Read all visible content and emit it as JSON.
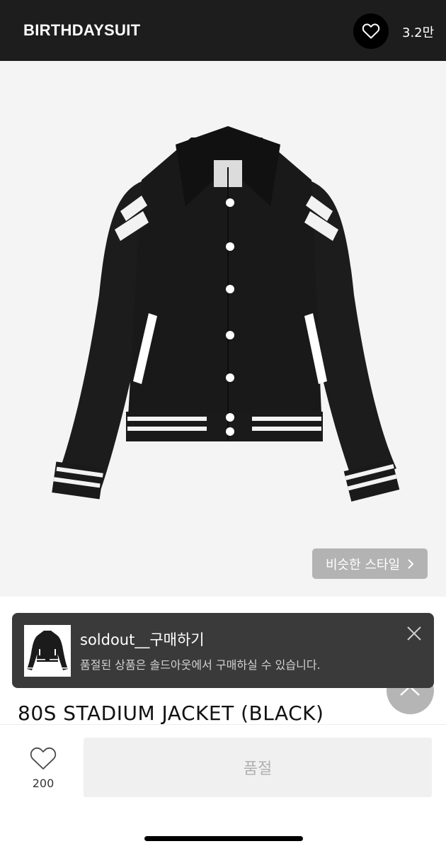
{
  "header": {
    "brand": "BIRTHDAYSUIT",
    "wish_count": "3.2만"
  },
  "hero": {
    "similar_style_label": "비슷한 스타일"
  },
  "toast": {
    "title": "soldout__구매하기",
    "description": "품절된 상품은 솔드아웃에서 구매하실 수 있습니다."
  },
  "product": {
    "title": "80S STADIUM JACKET (BLACK)"
  },
  "bottom_bar": {
    "like_count": "200",
    "soldout_label": "품절"
  },
  "colors": {
    "header_bg": "#1d1d1d",
    "hero_bg": "#f4f4f4",
    "toast_bg": "#3a3a3a",
    "soldout_bg": "#f0f0f0"
  },
  "icons": {
    "wishlist": "heart-icon",
    "similar_style_arrow": "chevron-right-icon",
    "toast_close": "close-icon",
    "like": "heart-outline-icon"
  }
}
